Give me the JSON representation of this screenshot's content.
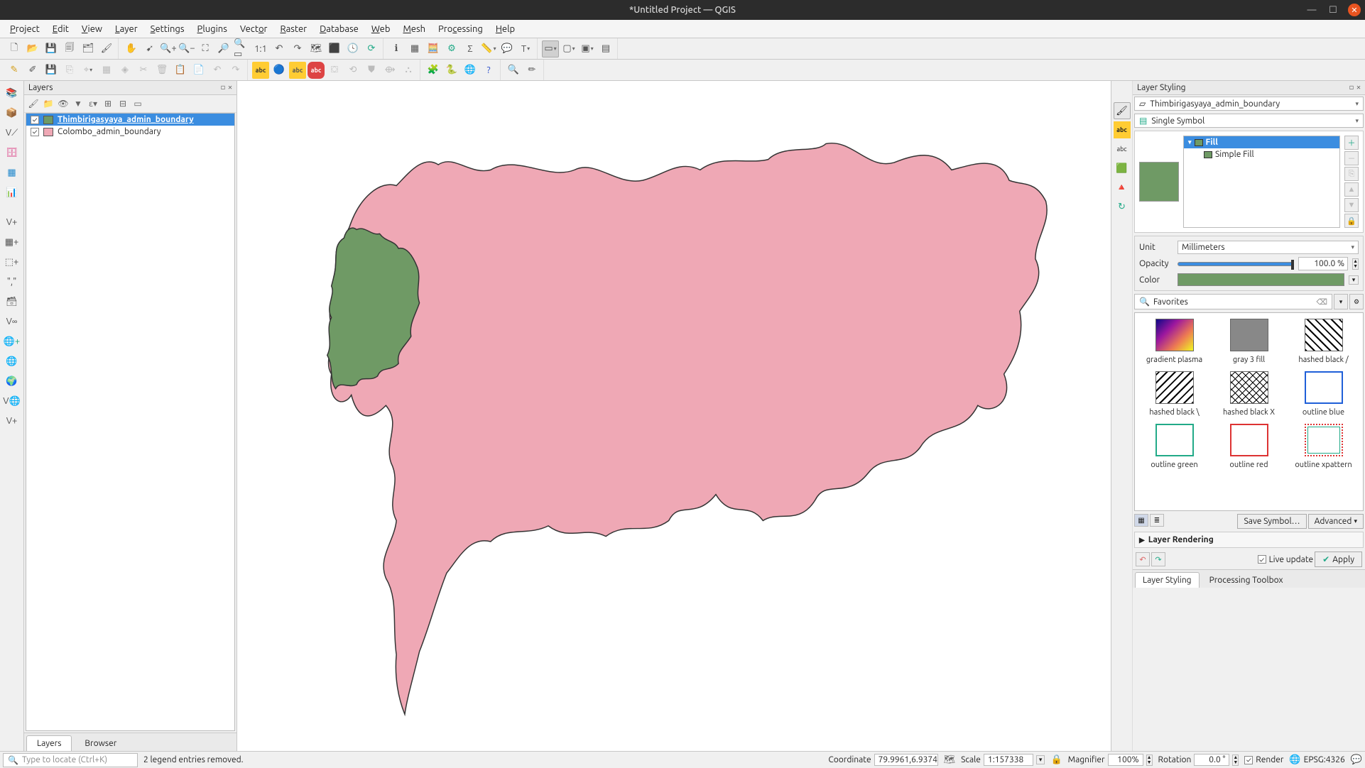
{
  "window": {
    "title": "*Untitled Project — QGIS"
  },
  "menu": {
    "project": "Project",
    "edit": "Edit",
    "view": "View",
    "layer": "Layer",
    "settings": "Settings",
    "plugins": "Plugins",
    "vector": "Vector",
    "raster": "Raster",
    "database": "Database",
    "web": "Web",
    "mesh": "Mesh",
    "processing": "Processing",
    "help": "Help"
  },
  "panels": {
    "layers_title": "Layers",
    "layer_styling_title": "Layer Styling"
  },
  "layers": [
    {
      "name": "Thimbirigasyaya_admin_boundary",
      "color": "#6f9a65",
      "checked": true,
      "selected": true
    },
    {
      "name": "Colombo_admin_boundary",
      "color": "#efa8b5",
      "checked": true,
      "selected": false
    }
  ],
  "left_tabs": {
    "layers": "Layers",
    "browser": "Browser"
  },
  "styling": {
    "layer_selected": "Thimbirigasyaya_admin_boundary",
    "renderer": "Single Symbol",
    "tree": {
      "fill": "Fill",
      "simple_fill": "Simple Fill"
    },
    "unit_label": "Unit",
    "unit_value": "Millimeters",
    "opacity_label": "Opacity",
    "opacity_value": "100.0 %",
    "color_label": "Color",
    "favorites_placeholder": "Favorites",
    "favorites": [
      "gradient plasma",
      "gray 3 fill",
      "hashed black /",
      "hashed black \\",
      "hashed black X",
      "outline blue",
      "outline green",
      "outline red",
      "outline xpattern"
    ],
    "save_symbol": "Save Symbol…",
    "advanced": "Advanced",
    "layer_rendering": "Layer Rendering",
    "live_update": "Live update",
    "apply": "Apply"
  },
  "right_tabs": {
    "styling": "Layer Styling",
    "toolbox": "Processing Toolbox"
  },
  "statusbar": {
    "locator_placeholder": "Type to locate (Ctrl+K)",
    "message": "2 legend entries removed.",
    "coordinate_label": "Coordinate",
    "coordinate_value": "79.9961,6.9374",
    "scale_label": "Scale",
    "scale_value": "1:157338",
    "magnifier_label": "Magnifier",
    "magnifier_value": "100%",
    "rotation_label": "Rotation",
    "rotation_value": "0.0 °",
    "render_label": "Render",
    "crs": "EPSG:4326"
  }
}
